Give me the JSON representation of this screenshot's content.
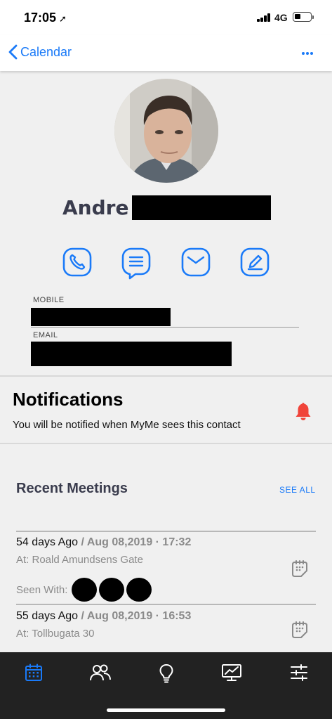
{
  "status_bar": {
    "time": "17:05",
    "network": "4G"
  },
  "nav": {
    "back_label": "Calendar"
  },
  "profile": {
    "name_first": "Andre",
    "mobile_label": "MOBILE",
    "email_label": "EMAIL"
  },
  "actions": [
    "phone-icon",
    "message-icon",
    "mail-icon",
    "edit-icon"
  ],
  "notifications": {
    "title": "Notifications",
    "description": "You will be notified when MyMe sees this contact",
    "bell_color": "#f0443a"
  },
  "recent_meetings": {
    "title": "Recent Meetings",
    "see_all": "SEE ALL",
    "items": [
      {
        "ago": "54 days Ago",
        "sep": " / ",
        "date": "Aug 08,2019 · 17:32",
        "at": "At: Roald Amundsens Gate",
        "seen_with": "Seen With:"
      },
      {
        "ago": "55 days Ago",
        "sep": " / ",
        "date": "Aug 08,2019 · 16:53",
        "at": "At: Tollbugata 30"
      }
    ]
  },
  "tab_bar": {
    "tabs": [
      "calendar-icon",
      "people-icon",
      "lightbulb-icon",
      "chart-icon",
      "settings-sliders-icon"
    ],
    "active_color": "#1a7af8",
    "inactive_color": "#ffffff"
  },
  "colors": {
    "accent": "#1a7af8",
    "heading": "#3a3c4d"
  }
}
